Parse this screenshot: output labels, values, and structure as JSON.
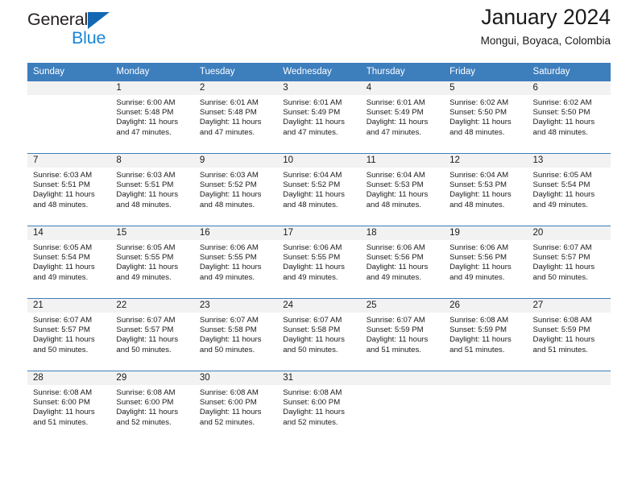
{
  "brand": {
    "line1": "General",
    "line2": "Blue",
    "triangle_color": "#1268b3",
    "blue_color": "#1a85d6"
  },
  "header": {
    "title": "January 2024",
    "location": "Mongui, Boyaca, Colombia"
  },
  "theme": {
    "header_row_bg": "#3d7ebd",
    "daynum_bg": "#f2f2f2",
    "grid_line": "#3d7ebd",
    "text": "#1a1a1a"
  },
  "labels": {
    "sunrise_prefix": "Sunrise:",
    "sunset_prefix": "Sunset:",
    "daylight_prefix": "Daylight:"
  },
  "weekdays": [
    "Sunday",
    "Monday",
    "Tuesday",
    "Wednesday",
    "Thursday",
    "Friday",
    "Saturday"
  ],
  "weeks": [
    [
      {
        "day": "",
        "empty": true
      },
      {
        "day": "1",
        "sunrise": "Sunrise: 6:00 AM",
        "sunset": "Sunset: 5:48 PM",
        "daylight1": "Daylight: 11 hours",
        "daylight2": "and 47 minutes."
      },
      {
        "day": "2",
        "sunrise": "Sunrise: 6:01 AM",
        "sunset": "Sunset: 5:48 PM",
        "daylight1": "Daylight: 11 hours",
        "daylight2": "and 47 minutes."
      },
      {
        "day": "3",
        "sunrise": "Sunrise: 6:01 AM",
        "sunset": "Sunset: 5:49 PM",
        "daylight1": "Daylight: 11 hours",
        "daylight2": "and 47 minutes."
      },
      {
        "day": "4",
        "sunrise": "Sunrise: 6:01 AM",
        "sunset": "Sunset: 5:49 PM",
        "daylight1": "Daylight: 11 hours",
        "daylight2": "and 47 minutes."
      },
      {
        "day": "5",
        "sunrise": "Sunrise: 6:02 AM",
        "sunset": "Sunset: 5:50 PM",
        "daylight1": "Daylight: 11 hours",
        "daylight2": "and 48 minutes."
      },
      {
        "day": "6",
        "sunrise": "Sunrise: 6:02 AM",
        "sunset": "Sunset: 5:50 PM",
        "daylight1": "Daylight: 11 hours",
        "daylight2": "and 48 minutes."
      }
    ],
    [
      {
        "day": "7",
        "sunrise": "Sunrise: 6:03 AM",
        "sunset": "Sunset: 5:51 PM",
        "daylight1": "Daylight: 11 hours",
        "daylight2": "and 48 minutes."
      },
      {
        "day": "8",
        "sunrise": "Sunrise: 6:03 AM",
        "sunset": "Sunset: 5:51 PM",
        "daylight1": "Daylight: 11 hours",
        "daylight2": "and 48 minutes."
      },
      {
        "day": "9",
        "sunrise": "Sunrise: 6:03 AM",
        "sunset": "Sunset: 5:52 PM",
        "daylight1": "Daylight: 11 hours",
        "daylight2": "and 48 minutes."
      },
      {
        "day": "10",
        "sunrise": "Sunrise: 6:04 AM",
        "sunset": "Sunset: 5:52 PM",
        "daylight1": "Daylight: 11 hours",
        "daylight2": "and 48 minutes."
      },
      {
        "day": "11",
        "sunrise": "Sunrise: 6:04 AM",
        "sunset": "Sunset: 5:53 PM",
        "daylight1": "Daylight: 11 hours",
        "daylight2": "and 48 minutes."
      },
      {
        "day": "12",
        "sunrise": "Sunrise: 6:04 AM",
        "sunset": "Sunset: 5:53 PM",
        "daylight1": "Daylight: 11 hours",
        "daylight2": "and 48 minutes."
      },
      {
        "day": "13",
        "sunrise": "Sunrise: 6:05 AM",
        "sunset": "Sunset: 5:54 PM",
        "daylight1": "Daylight: 11 hours",
        "daylight2": "and 49 minutes."
      }
    ],
    [
      {
        "day": "14",
        "sunrise": "Sunrise: 6:05 AM",
        "sunset": "Sunset: 5:54 PM",
        "daylight1": "Daylight: 11 hours",
        "daylight2": "and 49 minutes."
      },
      {
        "day": "15",
        "sunrise": "Sunrise: 6:05 AM",
        "sunset": "Sunset: 5:55 PM",
        "daylight1": "Daylight: 11 hours",
        "daylight2": "and 49 minutes."
      },
      {
        "day": "16",
        "sunrise": "Sunrise: 6:06 AM",
        "sunset": "Sunset: 5:55 PM",
        "daylight1": "Daylight: 11 hours",
        "daylight2": "and 49 minutes."
      },
      {
        "day": "17",
        "sunrise": "Sunrise: 6:06 AM",
        "sunset": "Sunset: 5:55 PM",
        "daylight1": "Daylight: 11 hours",
        "daylight2": "and 49 minutes."
      },
      {
        "day": "18",
        "sunrise": "Sunrise: 6:06 AM",
        "sunset": "Sunset: 5:56 PM",
        "daylight1": "Daylight: 11 hours",
        "daylight2": "and 49 minutes."
      },
      {
        "day": "19",
        "sunrise": "Sunrise: 6:06 AM",
        "sunset": "Sunset: 5:56 PM",
        "daylight1": "Daylight: 11 hours",
        "daylight2": "and 49 minutes."
      },
      {
        "day": "20",
        "sunrise": "Sunrise: 6:07 AM",
        "sunset": "Sunset: 5:57 PM",
        "daylight1": "Daylight: 11 hours",
        "daylight2": "and 50 minutes."
      }
    ],
    [
      {
        "day": "21",
        "sunrise": "Sunrise: 6:07 AM",
        "sunset": "Sunset: 5:57 PM",
        "daylight1": "Daylight: 11 hours",
        "daylight2": "and 50 minutes."
      },
      {
        "day": "22",
        "sunrise": "Sunrise: 6:07 AM",
        "sunset": "Sunset: 5:57 PM",
        "daylight1": "Daylight: 11 hours",
        "daylight2": "and 50 minutes."
      },
      {
        "day": "23",
        "sunrise": "Sunrise: 6:07 AM",
        "sunset": "Sunset: 5:58 PM",
        "daylight1": "Daylight: 11 hours",
        "daylight2": "and 50 minutes."
      },
      {
        "day": "24",
        "sunrise": "Sunrise: 6:07 AM",
        "sunset": "Sunset: 5:58 PM",
        "daylight1": "Daylight: 11 hours",
        "daylight2": "and 50 minutes."
      },
      {
        "day": "25",
        "sunrise": "Sunrise: 6:07 AM",
        "sunset": "Sunset: 5:59 PM",
        "daylight1": "Daylight: 11 hours",
        "daylight2": "and 51 minutes."
      },
      {
        "day": "26",
        "sunrise": "Sunrise: 6:08 AM",
        "sunset": "Sunset: 5:59 PM",
        "daylight1": "Daylight: 11 hours",
        "daylight2": "and 51 minutes."
      },
      {
        "day": "27",
        "sunrise": "Sunrise: 6:08 AM",
        "sunset": "Sunset: 5:59 PM",
        "daylight1": "Daylight: 11 hours",
        "daylight2": "and 51 minutes."
      }
    ],
    [
      {
        "day": "28",
        "sunrise": "Sunrise: 6:08 AM",
        "sunset": "Sunset: 6:00 PM",
        "daylight1": "Daylight: 11 hours",
        "daylight2": "and 51 minutes."
      },
      {
        "day": "29",
        "sunrise": "Sunrise: 6:08 AM",
        "sunset": "Sunset: 6:00 PM",
        "daylight1": "Daylight: 11 hours",
        "daylight2": "and 52 minutes."
      },
      {
        "day": "30",
        "sunrise": "Sunrise: 6:08 AM",
        "sunset": "Sunset: 6:00 PM",
        "daylight1": "Daylight: 11 hours",
        "daylight2": "and 52 minutes."
      },
      {
        "day": "31",
        "sunrise": "Sunrise: 6:08 AM",
        "sunset": "Sunset: 6:00 PM",
        "daylight1": "Daylight: 11 hours",
        "daylight2": "and 52 minutes."
      },
      {
        "day": "",
        "empty": true
      },
      {
        "day": "",
        "empty": true
      },
      {
        "day": "",
        "empty": true
      }
    ]
  ]
}
